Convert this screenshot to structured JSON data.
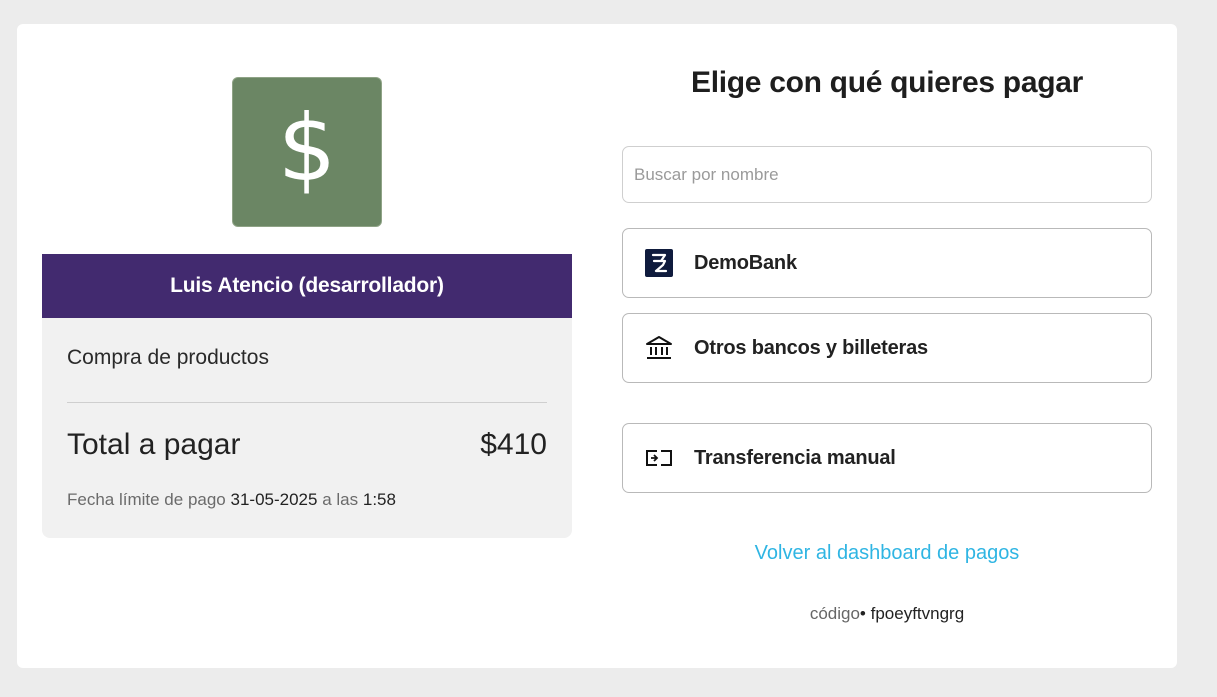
{
  "merchant": {
    "logo_symbol": "$",
    "logo_color": "#6b8664",
    "name": "Luis Atencio (desarrollador)",
    "bar_color": "#422a6f"
  },
  "summary": {
    "concept": "Compra de productos",
    "total_label": "Total a pagar",
    "total_value": "$410",
    "due_prefix": "Fecha límite de pago",
    "due_date": "31-05-2025",
    "due_mid": "a las",
    "due_time": "1:58"
  },
  "payment": {
    "heading": "Elige con qué quieres pagar",
    "search_placeholder": "Buscar por nombre",
    "options": [
      {
        "label": "DemoBank",
        "icon": "demobank-logo-icon"
      },
      {
        "label": "Otros bancos y billeteras",
        "icon": "bank-building-icon"
      },
      {
        "label": "Transferencia manual",
        "icon": "transfer-icon"
      }
    ],
    "back_link": "Volver al dashboard de pagos",
    "code_label": "código",
    "code_separator": "•",
    "code_value": "fpoeyftvngrg",
    "link_color": "#2fb5e3"
  }
}
